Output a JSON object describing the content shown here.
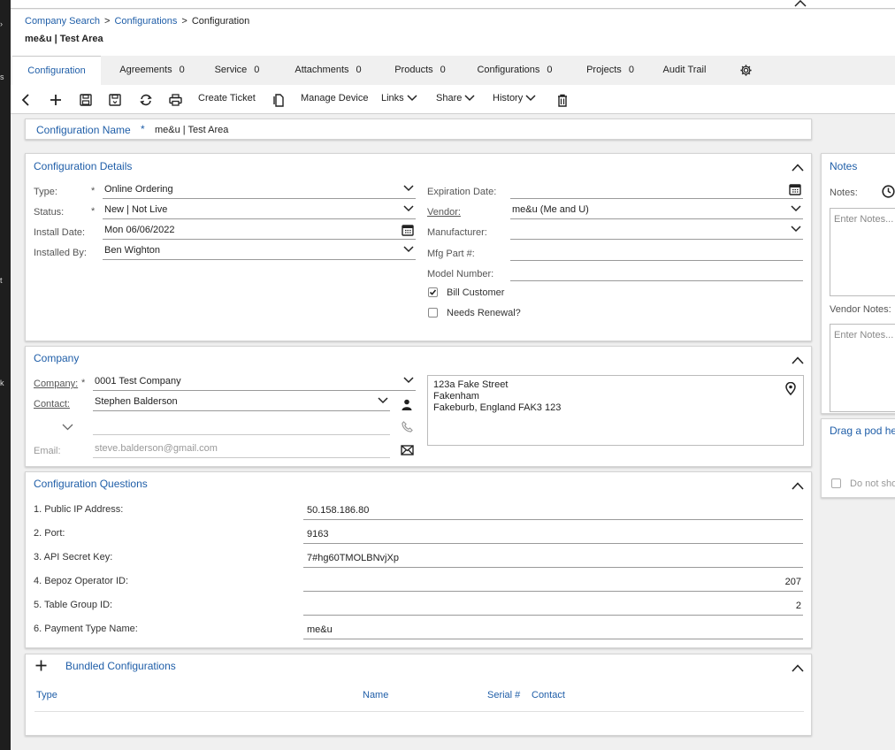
{
  "breadcrumb": {
    "items": [
      "Company Search",
      "Configurations",
      "Configuration"
    ]
  },
  "record_title": "me&u | Test Area",
  "tabs": [
    {
      "label": "Configuration",
      "count": ""
    },
    {
      "label": "Agreements",
      "count": "0"
    },
    {
      "label": "Service",
      "count": "0"
    },
    {
      "label": "Attachments",
      "count": "0"
    },
    {
      "label": "Products",
      "count": "0"
    },
    {
      "label": "Configurations",
      "count": "0"
    },
    {
      "label": "Projects",
      "count": "0"
    },
    {
      "label": "Audit Trail",
      "count": ""
    }
  ],
  "toolbar": {
    "create_ticket": "Create Ticket",
    "manage_device": "Manage Device",
    "links": "Links",
    "share": "Share",
    "history": "History"
  },
  "config_name": {
    "label": "Configuration Name",
    "required": "*",
    "value": "me&u | Test Area"
  },
  "details": {
    "title": "Configuration Details",
    "type": {
      "label": "Type:",
      "value": "Online Ordering"
    },
    "status": {
      "label": "Status:",
      "value": "New | Not Live"
    },
    "install_date": {
      "label": "Install Date:",
      "value": "Mon 06/06/2022"
    },
    "installed_by": {
      "label": "Installed By:",
      "value": "Ben Wighton"
    },
    "expiration_date": {
      "label": "Expiration Date:",
      "value": ""
    },
    "vendor": {
      "label": "Vendor:",
      "value": "me&u (Me and U)"
    },
    "manufacturer": {
      "label": "Manufacturer:",
      "value": ""
    },
    "mfg_part": {
      "label": "Mfg Part #:",
      "value": ""
    },
    "model_number": {
      "label": "Model Number:",
      "value": ""
    },
    "bill_customer": {
      "label": "Bill Customer",
      "checked": true
    },
    "needs_renewal": {
      "label": "Needs Renewal?",
      "checked": false
    },
    "required_mark": "*"
  },
  "company": {
    "title": "Company",
    "company": {
      "label": "Company:",
      "value": "0001 Test Company"
    },
    "contact": {
      "label": "Contact:",
      "value": "Stephen Balderson"
    },
    "email": {
      "label": "Email:",
      "value": "steve.balderson@gmail.com"
    },
    "address": [
      "123a Fake Street",
      "Fakenham",
      "Fakeburb, England FAK3 123"
    ]
  },
  "questions": {
    "title": "Configuration Questions",
    "items": [
      {
        "label": "1. Public IP Address:",
        "value": "50.158.186.80",
        "align": "left"
      },
      {
        "label": "2. Port:",
        "value": "9163",
        "align": "left"
      },
      {
        "label": "3. API Secret Key:",
        "value": "7#hg60TMOLBNvjXp",
        "align": "left"
      },
      {
        "label": "4. Bepoz Operator ID:",
        "value": "207",
        "align": "right"
      },
      {
        "label": "5. Table Group ID:",
        "value": "2",
        "align": "right"
      },
      {
        "label": "6. Payment Type Name:",
        "value": "me&u",
        "align": "left"
      }
    ]
  },
  "bundled": {
    "title": "Bundled Configurations",
    "columns": {
      "type": "Type",
      "name": "Name",
      "serial": "Serial #",
      "contact": "Contact"
    }
  },
  "notes": {
    "title": "Notes",
    "notes_label": "Notes:",
    "notes_placeholder": "Enter Notes...",
    "vendor_notes_label": "Vendor Notes:",
    "vendor_notes_placeholder": "Enter Notes..."
  },
  "drag_pod": {
    "text": "Drag a pod he",
    "do_not_show": "Do not sho"
  },
  "colors": {
    "accent": "#1f5ea8",
    "sidebar": "#1e1e1e"
  }
}
